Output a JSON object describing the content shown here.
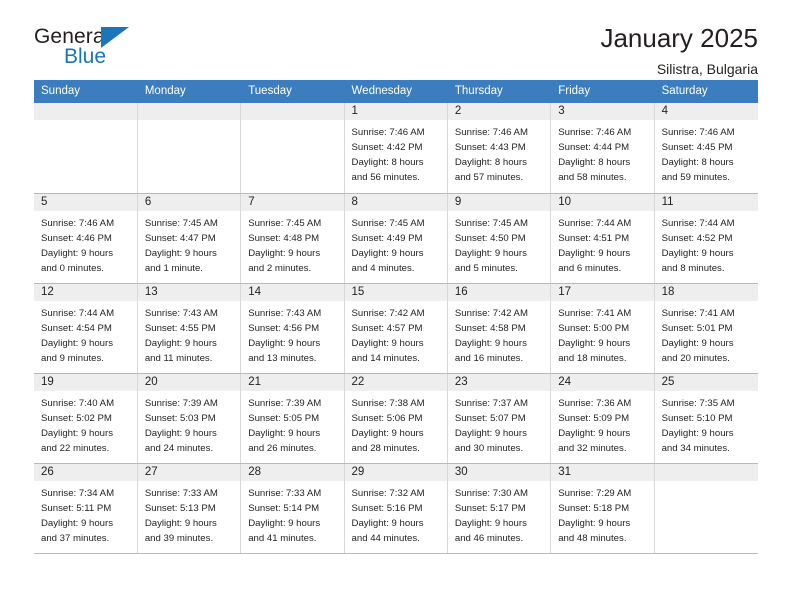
{
  "brand": {
    "name_top": "General",
    "name_bottom": "Blue",
    "accent_color": "#1b75bb",
    "text_color": "#231f20"
  },
  "header": {
    "title": "January 2025",
    "subtitle": "Silistra, Bulgaria"
  },
  "calendar": {
    "header_bg": "#3b7dbf",
    "daynum_bg": "#eeeeee",
    "weekdays": [
      "Sunday",
      "Monday",
      "Tuesday",
      "Wednesday",
      "Thursday",
      "Friday",
      "Saturday"
    ],
    "labels": {
      "sunrise": "Sunrise:",
      "sunset": "Sunset:",
      "daylight": "Daylight:"
    },
    "weeks": [
      [
        {
          "day": "",
          "empty": true
        },
        {
          "day": "",
          "empty": true
        },
        {
          "day": "",
          "empty": true
        },
        {
          "day": "1",
          "sunrise": "Sunrise: 7:46 AM",
          "sunset": "Sunset: 4:42 PM",
          "daylight1": "Daylight: 8 hours",
          "daylight2": "and 56 minutes."
        },
        {
          "day": "2",
          "sunrise": "Sunrise: 7:46 AM",
          "sunset": "Sunset: 4:43 PM",
          "daylight1": "Daylight: 8 hours",
          "daylight2": "and 57 minutes."
        },
        {
          "day": "3",
          "sunrise": "Sunrise: 7:46 AM",
          "sunset": "Sunset: 4:44 PM",
          "daylight1": "Daylight: 8 hours",
          "daylight2": "and 58 minutes."
        },
        {
          "day": "4",
          "sunrise": "Sunrise: 7:46 AM",
          "sunset": "Sunset: 4:45 PM",
          "daylight1": "Daylight: 8 hours",
          "daylight2": "and 59 minutes."
        }
      ],
      [
        {
          "day": "5",
          "sunrise": "Sunrise: 7:46 AM",
          "sunset": "Sunset: 4:46 PM",
          "daylight1": "Daylight: 9 hours",
          "daylight2": "and 0 minutes."
        },
        {
          "day": "6",
          "sunrise": "Sunrise: 7:45 AM",
          "sunset": "Sunset: 4:47 PM",
          "daylight1": "Daylight: 9 hours",
          "daylight2": "and 1 minute."
        },
        {
          "day": "7",
          "sunrise": "Sunrise: 7:45 AM",
          "sunset": "Sunset: 4:48 PM",
          "daylight1": "Daylight: 9 hours",
          "daylight2": "and 2 minutes."
        },
        {
          "day": "8",
          "sunrise": "Sunrise: 7:45 AM",
          "sunset": "Sunset: 4:49 PM",
          "daylight1": "Daylight: 9 hours",
          "daylight2": "and 4 minutes."
        },
        {
          "day": "9",
          "sunrise": "Sunrise: 7:45 AM",
          "sunset": "Sunset: 4:50 PM",
          "daylight1": "Daylight: 9 hours",
          "daylight2": "and 5 minutes."
        },
        {
          "day": "10",
          "sunrise": "Sunrise: 7:44 AM",
          "sunset": "Sunset: 4:51 PM",
          "daylight1": "Daylight: 9 hours",
          "daylight2": "and 6 minutes."
        },
        {
          "day": "11",
          "sunrise": "Sunrise: 7:44 AM",
          "sunset": "Sunset: 4:52 PM",
          "daylight1": "Daylight: 9 hours",
          "daylight2": "and 8 minutes."
        }
      ],
      [
        {
          "day": "12",
          "sunrise": "Sunrise: 7:44 AM",
          "sunset": "Sunset: 4:54 PM",
          "daylight1": "Daylight: 9 hours",
          "daylight2": "and 9 minutes."
        },
        {
          "day": "13",
          "sunrise": "Sunrise: 7:43 AM",
          "sunset": "Sunset: 4:55 PM",
          "daylight1": "Daylight: 9 hours",
          "daylight2": "and 11 minutes."
        },
        {
          "day": "14",
          "sunrise": "Sunrise: 7:43 AM",
          "sunset": "Sunset: 4:56 PM",
          "daylight1": "Daylight: 9 hours",
          "daylight2": "and 13 minutes."
        },
        {
          "day": "15",
          "sunrise": "Sunrise: 7:42 AM",
          "sunset": "Sunset: 4:57 PM",
          "daylight1": "Daylight: 9 hours",
          "daylight2": "and 14 minutes."
        },
        {
          "day": "16",
          "sunrise": "Sunrise: 7:42 AM",
          "sunset": "Sunset: 4:58 PM",
          "daylight1": "Daylight: 9 hours",
          "daylight2": "and 16 minutes."
        },
        {
          "day": "17",
          "sunrise": "Sunrise: 7:41 AM",
          "sunset": "Sunset: 5:00 PM",
          "daylight1": "Daylight: 9 hours",
          "daylight2": "and 18 minutes."
        },
        {
          "day": "18",
          "sunrise": "Sunrise: 7:41 AM",
          "sunset": "Sunset: 5:01 PM",
          "daylight1": "Daylight: 9 hours",
          "daylight2": "and 20 minutes."
        }
      ],
      [
        {
          "day": "19",
          "sunrise": "Sunrise: 7:40 AM",
          "sunset": "Sunset: 5:02 PM",
          "daylight1": "Daylight: 9 hours",
          "daylight2": "and 22 minutes."
        },
        {
          "day": "20",
          "sunrise": "Sunrise: 7:39 AM",
          "sunset": "Sunset: 5:03 PM",
          "daylight1": "Daylight: 9 hours",
          "daylight2": "and 24 minutes."
        },
        {
          "day": "21",
          "sunrise": "Sunrise: 7:39 AM",
          "sunset": "Sunset: 5:05 PM",
          "daylight1": "Daylight: 9 hours",
          "daylight2": "and 26 minutes."
        },
        {
          "day": "22",
          "sunrise": "Sunrise: 7:38 AM",
          "sunset": "Sunset: 5:06 PM",
          "daylight1": "Daylight: 9 hours",
          "daylight2": "and 28 minutes."
        },
        {
          "day": "23",
          "sunrise": "Sunrise: 7:37 AM",
          "sunset": "Sunset: 5:07 PM",
          "daylight1": "Daylight: 9 hours",
          "daylight2": "and 30 minutes."
        },
        {
          "day": "24",
          "sunrise": "Sunrise: 7:36 AM",
          "sunset": "Sunset: 5:09 PM",
          "daylight1": "Daylight: 9 hours",
          "daylight2": "and 32 minutes."
        },
        {
          "day": "25",
          "sunrise": "Sunrise: 7:35 AM",
          "sunset": "Sunset: 5:10 PM",
          "daylight1": "Daylight: 9 hours",
          "daylight2": "and 34 minutes."
        }
      ],
      [
        {
          "day": "26",
          "sunrise": "Sunrise: 7:34 AM",
          "sunset": "Sunset: 5:11 PM",
          "daylight1": "Daylight: 9 hours",
          "daylight2": "and 37 minutes."
        },
        {
          "day": "27",
          "sunrise": "Sunrise: 7:33 AM",
          "sunset": "Sunset: 5:13 PM",
          "daylight1": "Daylight: 9 hours",
          "daylight2": "and 39 minutes."
        },
        {
          "day": "28",
          "sunrise": "Sunrise: 7:33 AM",
          "sunset": "Sunset: 5:14 PM",
          "daylight1": "Daylight: 9 hours",
          "daylight2": "and 41 minutes."
        },
        {
          "day": "29",
          "sunrise": "Sunrise: 7:32 AM",
          "sunset": "Sunset: 5:16 PM",
          "daylight1": "Daylight: 9 hours",
          "daylight2": "and 44 minutes."
        },
        {
          "day": "30",
          "sunrise": "Sunrise: 7:30 AM",
          "sunset": "Sunset: 5:17 PM",
          "daylight1": "Daylight: 9 hours",
          "daylight2": "and 46 minutes."
        },
        {
          "day": "31",
          "sunrise": "Sunrise: 7:29 AM",
          "sunset": "Sunset: 5:18 PM",
          "daylight1": "Daylight: 9 hours",
          "daylight2": "and 48 minutes."
        },
        {
          "day": "",
          "empty": true
        }
      ]
    ]
  }
}
